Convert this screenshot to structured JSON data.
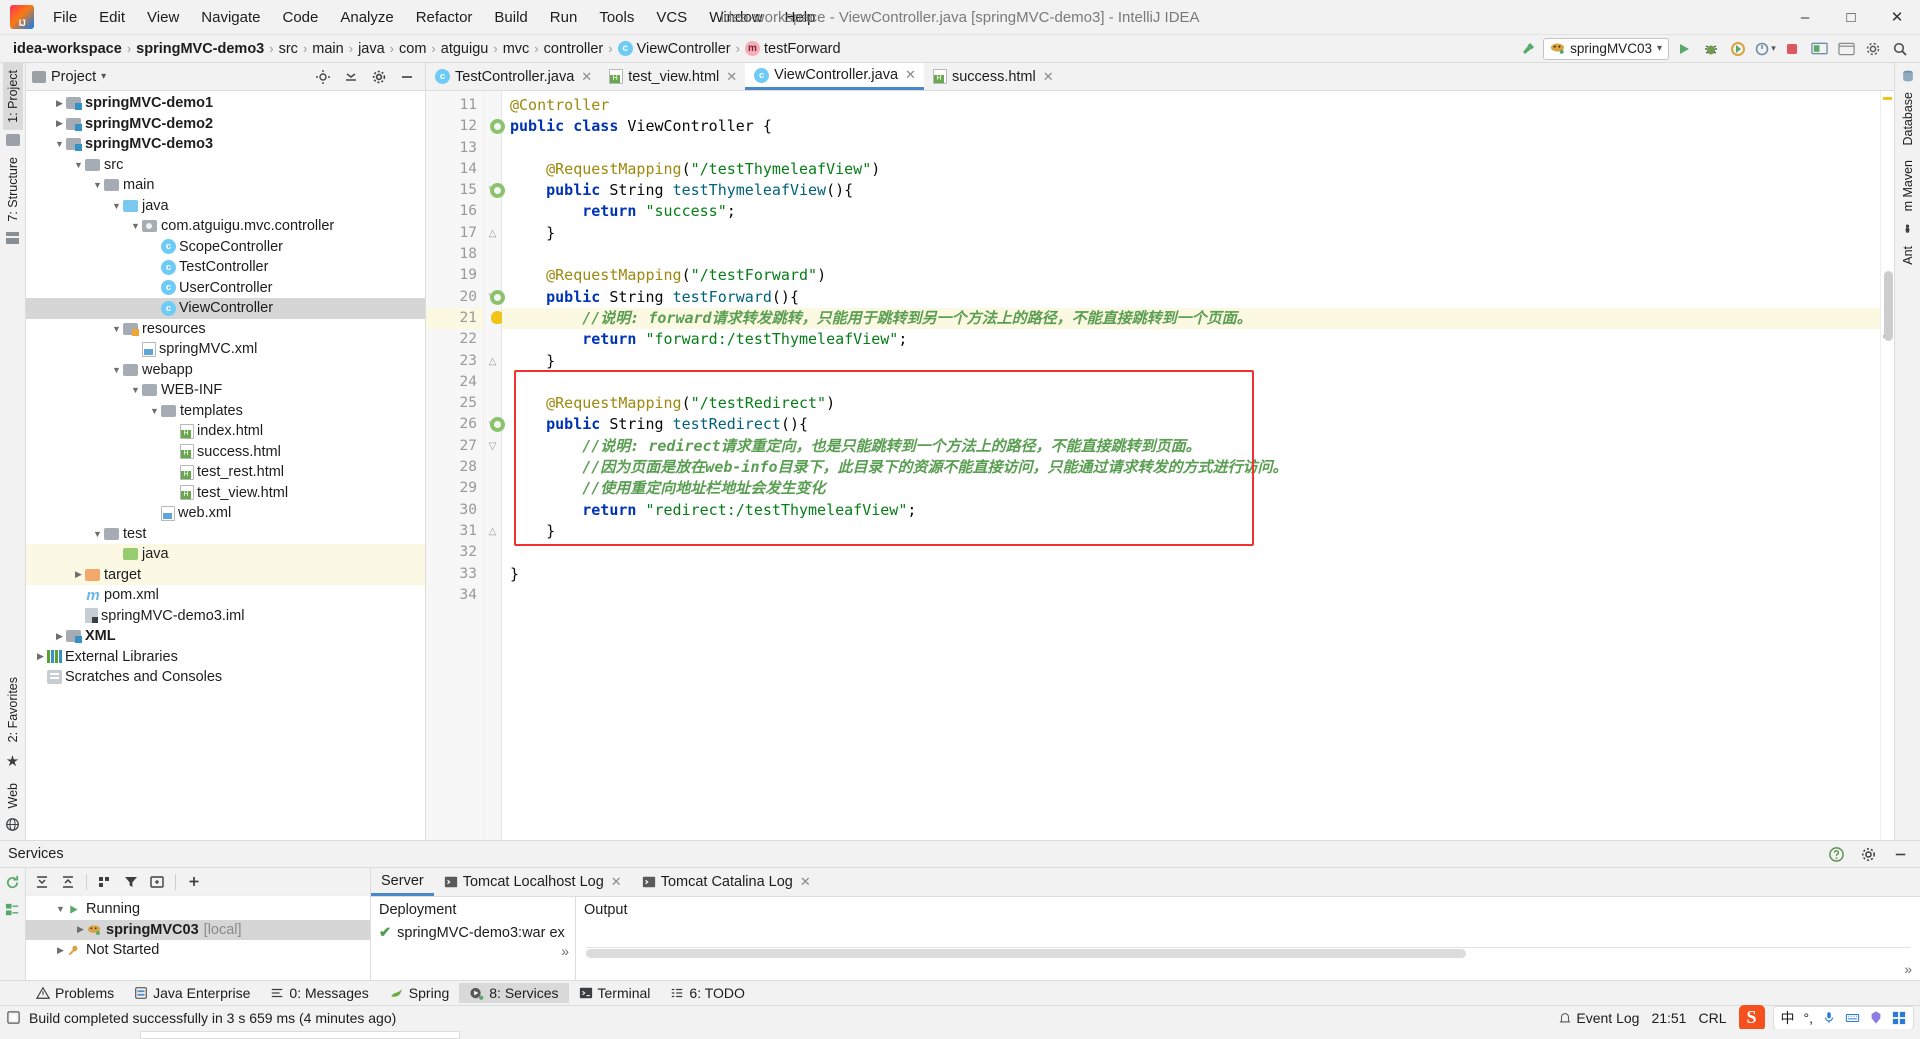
{
  "window": {
    "title": "idea-workspace - ViewController.java [springMVC-demo3] - IntelliJ IDEA",
    "minimize": "–",
    "maximize": "□",
    "close": "✕"
  },
  "menubar": [
    {
      "label": "File"
    },
    {
      "label": "Edit"
    },
    {
      "label": "View"
    },
    {
      "label": "Navigate"
    },
    {
      "label": "Code"
    },
    {
      "label": "Analyze"
    },
    {
      "label": "Refactor"
    },
    {
      "label": "Build"
    },
    {
      "label": "Run"
    },
    {
      "label": "Tools"
    },
    {
      "label": "VCS"
    },
    {
      "label": "Window"
    },
    {
      "label": "Help"
    }
  ],
  "navbar": {
    "crumbs": [
      {
        "label": "idea-workspace",
        "bold": true,
        "icon": ""
      },
      {
        "label": "springMVC-demo3",
        "bold": true,
        "icon": ""
      },
      {
        "label": "src",
        "bold": false,
        "icon": ""
      },
      {
        "label": "main",
        "bold": false,
        "icon": ""
      },
      {
        "label": "java",
        "bold": false,
        "icon": ""
      },
      {
        "label": "com",
        "bold": false,
        "icon": ""
      },
      {
        "label": "atguigu",
        "bold": false,
        "icon": ""
      },
      {
        "label": "mvc",
        "bold": false,
        "icon": ""
      },
      {
        "label": "controller",
        "bold": false,
        "icon": ""
      },
      {
        "label": "ViewController",
        "bold": false,
        "icon": "class-badge"
      },
      {
        "label": "testForward",
        "bold": false,
        "icon": "method-badge"
      }
    ],
    "separator": "›",
    "run_config": {
      "name": "springMVC03",
      "icon": "tomcat-icon",
      "chevron": "▾"
    },
    "class_badge_letter": "c",
    "method_badge_letter": "m"
  },
  "left_tool_tabs": [
    {
      "label": "1: Project",
      "active": true
    },
    {
      "label": "7: Structure",
      "active": false
    }
  ],
  "left_bottom_tabs": [
    {
      "label": "2: Favorites",
      "active": false
    },
    {
      "label": "Web",
      "active": false
    }
  ],
  "right_tool_tabs": [
    {
      "label": "Database",
      "active": false
    },
    {
      "label": "m Maven",
      "active": false
    },
    {
      "label": "Ant",
      "active": false
    }
  ],
  "project_panel": {
    "title": "Project",
    "chevron": "▾",
    "icons": [
      "locate-icon",
      "collapse-all-icon",
      "settings-icon",
      "hide-icon"
    ],
    "tree": [
      {
        "indent": 1,
        "arrow": "▶",
        "icon": "module-folder",
        "label": "springMVC-demo1",
        "bold": true
      },
      {
        "indent": 1,
        "arrow": "▶",
        "icon": "module-folder",
        "label": "springMVC-demo2",
        "bold": true
      },
      {
        "indent": 1,
        "arrow": "▼",
        "icon": "module-folder",
        "label": "springMVC-demo3",
        "bold": true
      },
      {
        "indent": 2,
        "arrow": "▼",
        "icon": "plain-folder",
        "label": "src",
        "bold": false
      },
      {
        "indent": 3,
        "arrow": "▼",
        "icon": "plain-folder",
        "label": "main",
        "bold": false
      },
      {
        "indent": 4,
        "arrow": "▼",
        "icon": "source-folder",
        "label": "java",
        "bold": false
      },
      {
        "indent": 5,
        "arrow": "▼",
        "icon": "package-folder",
        "label": "com.atguigu.mvc.controller",
        "bold": false
      },
      {
        "indent": 6,
        "arrow": "",
        "icon": "java-class",
        "label": "ScopeController",
        "bold": false
      },
      {
        "indent": 6,
        "arrow": "",
        "icon": "java-class",
        "label": "TestController",
        "bold": false
      },
      {
        "indent": 6,
        "arrow": "",
        "icon": "java-class",
        "label": "UserController",
        "bold": false
      },
      {
        "indent": 6,
        "arrow": "",
        "icon": "java-class",
        "label": "ViewController",
        "bold": false,
        "selected": true
      },
      {
        "indent": 4,
        "arrow": "▼",
        "icon": "resources-folder",
        "label": "resources",
        "bold": false
      },
      {
        "indent": 5,
        "arrow": "",
        "icon": "xml-file",
        "label": "springMVC.xml",
        "bold": false
      },
      {
        "indent": 4,
        "arrow": "▼",
        "icon": "plain-folder",
        "label": "webapp",
        "bold": false
      },
      {
        "indent": 5,
        "arrow": "▼",
        "icon": "plain-folder",
        "label": "WEB-INF",
        "bold": false
      },
      {
        "indent": 6,
        "arrow": "▼",
        "icon": "plain-folder",
        "label": "templates",
        "bold": false
      },
      {
        "indent": 7,
        "arrow": "",
        "icon": "html-file",
        "label": "index.html",
        "bold": false
      },
      {
        "indent": 7,
        "arrow": "",
        "icon": "html-file",
        "label": "success.html",
        "bold": false
      },
      {
        "indent": 7,
        "arrow": "",
        "icon": "html-file",
        "label": "test_rest.html",
        "bold": false
      },
      {
        "indent": 7,
        "arrow": "",
        "icon": "html-file",
        "label": "test_view.html",
        "bold": false
      },
      {
        "indent": 6,
        "arrow": "",
        "icon": "xml-file",
        "label": "web.xml",
        "bold": false
      },
      {
        "indent": 3,
        "arrow": "▼",
        "icon": "plain-folder",
        "label": "test",
        "bold": false
      },
      {
        "indent": 4,
        "arrow": "",
        "icon": "test-folder",
        "label": "java",
        "bold": false,
        "highlight": true
      },
      {
        "indent": 2,
        "arrow": "▶",
        "icon": "target-folder",
        "label": "target",
        "bold": false,
        "highlight": true
      },
      {
        "indent": 2,
        "arrow": "",
        "icon": "maven-file",
        "label": "pom.xml",
        "bold": false
      },
      {
        "indent": 2,
        "arrow": "",
        "icon": "iml-file",
        "label": "springMVC-demo3.iml",
        "bold": false
      },
      {
        "indent": 1,
        "arrow": "▶",
        "icon": "module-folder",
        "label": "XML",
        "bold": true
      },
      {
        "indent": 0,
        "arrow": "▶",
        "icon": "library-icon",
        "label": "External Libraries",
        "bold": false
      },
      {
        "indent": 0,
        "arrow": "",
        "icon": "scratch-icon",
        "label": "Scratches and Consoles",
        "bold": false
      }
    ]
  },
  "editor": {
    "tabs": [
      {
        "label": "TestController.java",
        "icon": "java-class",
        "active": false,
        "close": "✕"
      },
      {
        "label": "test_view.html",
        "icon": "html-file",
        "active": false,
        "close": "✕"
      },
      {
        "label": "ViewController.java",
        "icon": "java-class",
        "active": true,
        "close": "✕"
      },
      {
        "label": "success.html",
        "icon": "html-file",
        "active": false,
        "close": "✕"
      }
    ],
    "first_line_number": 11,
    "lines": [
      {
        "n": 11,
        "gutter_icon": "",
        "fold": "",
        "html": "<span class=\"ann\">@Controller</span>"
      },
      {
        "n": 12,
        "gutter_icon": "bean",
        "fold": "",
        "html": "<span class=\"kw\">public</span> <span class=\"kw\">class</span> <span class=\"plain\">ViewController</span> <span class=\"plain\">{</span>"
      },
      {
        "n": 13,
        "gutter_icon": "",
        "fold": "",
        "html": ""
      },
      {
        "n": 14,
        "gutter_icon": "",
        "fold": "",
        "html": "    <span class=\"ann\">@RequestMapping</span><span class=\"plain\">(</span><span class=\"str\">\"/testThymeleafView\"</span><span class=\"plain\">)</span>"
      },
      {
        "n": 15,
        "gutter_icon": "bean",
        "fold": "▽",
        "html": "    <span class=\"kw\">public</span> <span class=\"plain\">String</span> <span class=\"mth\">testThymeleafView</span><span class=\"plain\">(){</span>"
      },
      {
        "n": 16,
        "gutter_icon": "",
        "fold": "",
        "html": "        <span class=\"kw\">return</span> <span class=\"str\">\"success\"</span><span class=\"plain\">;</span>"
      },
      {
        "n": 17,
        "gutter_icon": "",
        "fold": "△",
        "html": "    <span class=\"plain\">}</span>"
      },
      {
        "n": 18,
        "gutter_icon": "",
        "fold": "",
        "html": ""
      },
      {
        "n": 19,
        "gutter_icon": "",
        "fold": "",
        "html": "    <span class=\"ann\">@RequestMapping</span><span class=\"plain\">(</span><span class=\"str\">\"/testForward\"</span><span class=\"plain\">)</span>"
      },
      {
        "n": 20,
        "gutter_icon": "bean",
        "fold": "▽",
        "html": "    <span class=\"kw\">public</span> <span class=\"plain\">String</span> <span class=\"mth\">testForward</span><span class=\"plain\">(){</span>"
      },
      {
        "n": 21,
        "gutter_icon": "bulb",
        "fold": "",
        "highlight": true,
        "html": "        <span class=\"cmtb\">//说明: forward请求转发跳转，只能用于跳转到另一个方法上的路径，不能直接跳转到一个页面。</span>"
      },
      {
        "n": 22,
        "gutter_icon": "",
        "fold": "",
        "html": "        <span class=\"kw\">return</span> <span class=\"str\">\"forward:/testThymeleafView\"</span><span class=\"plain\">;</span>"
      },
      {
        "n": 23,
        "gutter_icon": "",
        "fold": "△",
        "html": "    <span class=\"plain\">}</span>"
      },
      {
        "n": 24,
        "gutter_icon": "",
        "fold": "",
        "html": ""
      },
      {
        "n": 25,
        "gutter_icon": "",
        "fold": "",
        "html": "    <span class=\"ann\">@RequestMapping</span><span class=\"plain\">(</span><span class=\"str\">\"/testRedirect\"</span><span class=\"plain\">)</span>"
      },
      {
        "n": 26,
        "gutter_icon": "bean",
        "fold": "▽",
        "html": "    <span class=\"kw\">public</span> <span class=\"plain\">String</span> <span class=\"mth\">testRedirect</span><span class=\"plain\">(){</span>"
      },
      {
        "n": 27,
        "gutter_icon": "",
        "fold": "▽",
        "html": "        <span class=\"cmtb\">//说明: redirect请求重定向，也是只能跳转到一个方法上的路径，不能直接跳转到页面。</span>"
      },
      {
        "n": 28,
        "gutter_icon": "",
        "fold": "",
        "html": "        <span class=\"cmtb\">//因为页面是放在web-info目录下，此目录下的资源不能直接访问，只能通过请求转发的方式进行访问。</span>"
      },
      {
        "n": 29,
        "gutter_icon": "",
        "fold": "",
        "html": "        <span class=\"cmtb\">//使用重定向地址栏地址会发生变化</span>"
      },
      {
        "n": 30,
        "gutter_icon": "",
        "fold": "",
        "html": "        <span class=\"kw\">return</span> <span class=\"str\">\"redirect:/testThymeleafView\"</span><span class=\"plain\">;</span>"
      },
      {
        "n": 31,
        "gutter_icon": "",
        "fold": "△",
        "html": "    <span class=\"plain\">}</span>"
      },
      {
        "n": 32,
        "gutter_icon": "",
        "fold": "",
        "html": ""
      },
      {
        "n": 33,
        "gutter_icon": "",
        "fold": "",
        "html": "<span class=\"plain\">}</span>"
      },
      {
        "n": 34,
        "gutter_icon": "",
        "fold": "",
        "html": ""
      }
    ],
    "highlight_box": {
      "from_line": 24,
      "to_line": 32,
      "color": "#f23030"
    }
  },
  "services": {
    "title": "Services",
    "header_icons": [
      "help-icon",
      "settings-icon",
      "hide-icon"
    ],
    "toolbar_icons": [
      "rerun-icon",
      "expand-all-icon",
      "collapse-all-icon",
      "group-icon",
      "filter-icon",
      "show-icon",
      "add-icon"
    ],
    "left_toolcol_icons": [
      "refresh-icon",
      "deploy-icon"
    ],
    "tree": [
      {
        "indent": 1,
        "arrow": "▼",
        "icon": "run-icon",
        "label": "Running",
        "bold": false
      },
      {
        "indent": 2,
        "arrow": "▶",
        "icon": "tomcat-icon",
        "label": "springMVC03",
        "suffix": "[local]",
        "bold": true,
        "selected": true
      },
      {
        "indent": 1,
        "arrow": "▶",
        "icon": "wrench-icon",
        "label": "Not Started",
        "bold": false
      }
    ],
    "right_tabs": [
      {
        "label": "Server",
        "icon": "",
        "active": true,
        "close": ""
      },
      {
        "label": "Tomcat Localhost Log",
        "icon": "console-icon",
        "active": false,
        "close": "✕"
      },
      {
        "label": "Tomcat Catalina Log",
        "icon": "console-icon",
        "active": false,
        "close": "✕"
      }
    ],
    "deployment_header": "Deployment",
    "output_header": "Output",
    "deployment_rows": [
      {
        "check": "✔",
        "label": "springMVC-demo3:war ex"
      }
    ],
    "expand_chevron": "»"
  },
  "tool_window_bar": [
    {
      "label": "Problems",
      "icon": "warning-icon",
      "active": false
    },
    {
      "label": "Java Enterprise",
      "icon": "jee-icon",
      "active": false
    },
    {
      "label": "0: Messages",
      "icon": "messages-icon",
      "active": false
    },
    {
      "label": "Spring",
      "icon": "spring-icon",
      "active": false
    },
    {
      "label": "8: Services",
      "icon": "services-icon",
      "active": true
    },
    {
      "label": "Terminal",
      "icon": "terminal-icon",
      "active": false
    },
    {
      "label": "6: TODO",
      "icon": "todo-icon",
      "active": false
    }
  ],
  "statusbar": {
    "icon": "build-icon",
    "message": "Build completed successfully in 3 s 659 ms (4 minutes ago)",
    "event_log": "Event Log",
    "event_log_icon": "bell-icon",
    "time": "21:51",
    "crlf": "CRL",
    "tray": {
      "sogou": "S",
      "items": [
        "中",
        "°,",
        "mic-icon",
        "keyboard-icon",
        "tools-icon",
        "apps-icon"
      ]
    }
  },
  "colors": {
    "accent": "#4a88c7",
    "highlight_box": "#f23030",
    "keyword": "#0033b3",
    "string": "#067d17",
    "annotation": "#9e880d",
    "comment": "#5a9e52",
    "method": "#00627a",
    "selection": "#d6d6d6",
    "line_highlight": "#fcf9e3"
  }
}
